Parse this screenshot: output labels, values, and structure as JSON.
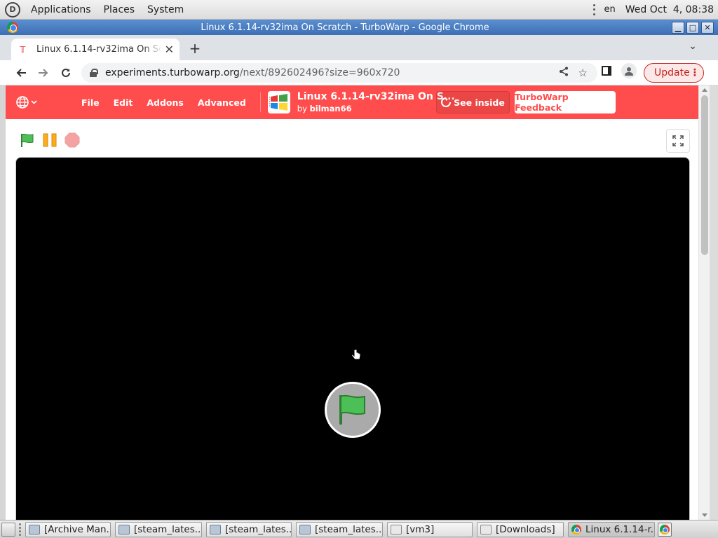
{
  "top_panel": {
    "menus": [
      "Applications",
      "Places",
      "System"
    ],
    "language": "en",
    "clock": "Wed Oct  4, 08:38"
  },
  "window": {
    "title": "Linux 6.1.14-rv32ima On Scratch - TurboWarp - Google Chrome",
    "buttons": [
      "minimize",
      "maximize",
      "close"
    ]
  },
  "browser": {
    "tab": {
      "title": "Linux 6.1.14-rv32ima On Scratch - TurboWarp",
      "favicon": "turbowarp-icon"
    },
    "url_host": "experiments.turbowarp.org",
    "url_path": "/next/892602496?size=960x720",
    "update_label": "Update"
  },
  "turbowarp": {
    "menus": [
      "File",
      "Edit",
      "Addons",
      "Advanced"
    ],
    "project_title": "Linux 6.1.14-rv32ima On S...",
    "by_label": "by",
    "author": "bilman66",
    "see_inside_label": "See inside",
    "feedback_label": "TurboWarp Feedback",
    "brand_color": "#ff4c4c"
  },
  "taskbar": {
    "tasks": [
      {
        "label": "[Archive Man...",
        "icon": "archive-manager-icon"
      },
      {
        "label": "[steam_lates...",
        "icon": "archive-manager-icon"
      },
      {
        "label": "[steam_lates...",
        "icon": "archive-manager-icon"
      },
      {
        "label": "[steam_lates...",
        "icon": "archive-manager-icon"
      },
      {
        "label": "[vm3]",
        "icon": "folder-icon"
      },
      {
        "label": "[Downloads]",
        "icon": "folder-icon"
      },
      {
        "label": "Linux 6.1.14-r...",
        "icon": "chrome-icon"
      }
    ]
  }
}
